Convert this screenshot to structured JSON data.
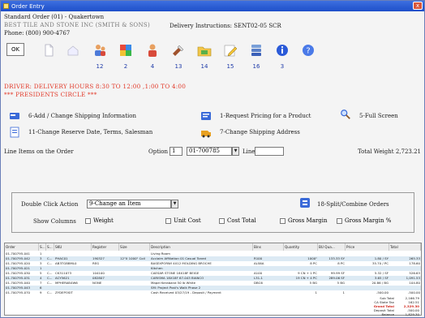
{
  "window": {
    "title": "Order Entry",
    "close_glyph": "x"
  },
  "header": {
    "order_line": "Standard Order (01) - Quakertown",
    "customer": "BEST TILE AND STONE INC (SMITH & SONS)",
    "delivery_instructions": "Delivery Instructions: SENT02-05 SCR",
    "phone": "Phone: (800) 900-4767"
  },
  "toolbar": {
    "ok_label": "OK",
    "buttons": [
      {
        "name": "new-doc-icon",
        "badge": ""
      },
      {
        "name": "home-icon",
        "badge": ""
      },
      {
        "name": "people-icon",
        "badge": "12"
      },
      {
        "name": "puzzle-icon",
        "badge": "2"
      },
      {
        "name": "contacts-icon",
        "badge": "4"
      },
      {
        "name": "tools-icon",
        "badge": "13"
      },
      {
        "name": "folder-icon",
        "badge": "14"
      },
      {
        "name": "pencil-icon",
        "badge": "15"
      },
      {
        "name": "database-icon",
        "badge": "16"
      },
      {
        "name": "info-icon",
        "badge": "3"
      },
      {
        "name": "help-icon",
        "badge": ""
      }
    ]
  },
  "alerts": {
    "driver": "DRIVER:  DELIVERY HOURS 8:30 TO 12:00 ,1:00 TO 4:00",
    "circle": "*** PRESIDENTS CIRCLE ***"
  },
  "actions": {
    "a6": "6-Add / Change Shipping Information",
    "a1": "1-Request Pricing for a Product",
    "a5": "5-Full Screen",
    "a11": "11-Change Reserve Date, Terms, Salesman",
    "a7": "7-Change Shipping Address"
  },
  "line_items": {
    "label": "Line Items on the Order",
    "option_label": "Option",
    "option_value": "1",
    "product_value": "01-700785",
    "line_label": "Line",
    "line_value": "",
    "total_weight": "Total Weight  2,723.21"
  },
  "dblclick": {
    "label": "Double Click Action",
    "value": "9-Change an Item",
    "split_label": "18-Split/Combine Orders",
    "show_columns_label": "Show Columns",
    "columns": [
      "Weight",
      "Unit Cost",
      "Cost Total",
      "Gross Margin",
      "Gross Margin %"
    ]
  },
  "grid": {
    "headers": [
      "Order",
      "S...",
      "S...",
      "SKU",
      "Register",
      "Size",
      "Description",
      "Bins",
      "Quantity",
      "BU Qua...",
      "Price",
      "Total"
    ],
    "rows": [
      [
        "01-700795-041",
        "1",
        "",
        "",
        "",
        "",
        "Living Room",
        "",
        "",
        "",
        "",
        ""
      ],
      [
        "01-700795-042",
        "3",
        "C...",
        "PHAC01",
        "190327",
        "12\"X 1000\" Coil",
        "Acclaim Affiliation 01 Casual Toned",
        "R100",
        "1000\"",
        "133.33 SY",
        "1.80 / SY",
        "265.33"
      ],
      [
        "01-700795-020",
        "3",
        "C...",
        "AB3TGBBML0",
        "REG",
        "",
        "BASEXPORWI 4X12 MOLDING BROCHE",
        "ALS6A",
        "8 PC",
        "8 PC",
        "35.70 / PC",
        "178.60"
      ],
      [
        "01-700795-021",
        "1",
        "",
        "",
        "",
        "",
        "Kitchen",
        "",
        "",
        "",
        "",
        ""
      ],
      [
        "01-700795-030",
        "5",
        "C...",
        "CK311073",
        "104100",
        "",
        "CAESAR STONE 18X18F BEIGE",
        "A100",
        "9 CN + 1 PC",
        "99.99 SF",
        "5.32 / SF",
        "526.63"
      ],
      [
        "01-700795-031",
        "4",
        "C...",
        "ACY5621",
        "082807",
        "",
        "CARISMA 18X18F 67-043 BIANCO",
        "L31-1",
        "19 CN + 4 PC",
        "289.06 SF",
        "3.65 / SF",
        "1,091.53"
      ],
      [
        "01-700795-040",
        "7",
        "C...",
        "MPHERAB4W6",
        "NONE",
        "",
        "Mapei Keraband 50 lb White",
        "DBC6",
        "5 BG",
        "5 BG",
        "20.86 / BG",
        "104.80"
      ],
      [
        "01-700795-043",
        "6",
        "",
        "",
        "",
        "",
        "SM: Project Post's Walk Phase 2",
        "",
        "",
        "",
        "",
        ""
      ],
      [
        "01-700795-070",
        "9",
        "C...",
        "ZYDEPOSIT",
        "",
        "",
        "Cash Received 03/27/19 - Deposit / Payment",
        "",
        "1",
        "1",
        "-500.00",
        "-500.00"
      ]
    ],
    "summary": [
      {
        "label": "Sub Total",
        "value": "2,166.79",
        "grand": false
      },
      {
        "label": "CA State Tax",
        "value": "162.51",
        "grand": false
      },
      {
        "label": "Grand Total",
        "value": "2,329.30",
        "grand": true
      },
      {
        "label": "Deposit Total",
        "value": "-500.00",
        "grand": false
      },
      {
        "label": "Balance",
        "value": "1,829.30",
        "grand": false
      }
    ]
  }
}
